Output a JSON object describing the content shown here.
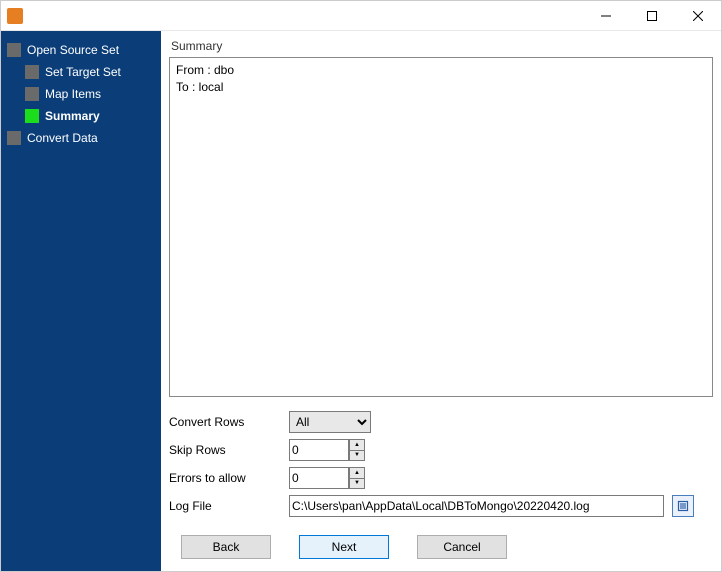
{
  "titlebar": {
    "title": ""
  },
  "sidebar": {
    "items": [
      {
        "label": "Open Source Set",
        "indent": 0,
        "active": false,
        "bold": false
      },
      {
        "label": "Set Target Set",
        "indent": 1,
        "active": false,
        "bold": false
      },
      {
        "label": "Map Items",
        "indent": 1,
        "active": false,
        "bold": false
      },
      {
        "label": "Summary",
        "indent": 1,
        "active": true,
        "bold": true
      },
      {
        "label": "Convert Data",
        "indent": 0,
        "active": false,
        "bold": false
      }
    ]
  },
  "content": {
    "group_label": "Summary",
    "summary_text": "From : dbo\nTo : local",
    "options": {
      "convert_rows_label": "Convert Rows",
      "convert_rows_value": "All",
      "skip_rows_label": "Skip Rows",
      "skip_rows_value": "0",
      "errors_label": "Errors to allow",
      "errors_value": "0",
      "logfile_label": "Log File",
      "logfile_value": "C:\\Users\\pan\\AppData\\Local\\DBToMongo\\20220420.log"
    }
  },
  "buttons": {
    "back": "Back",
    "next": "Next",
    "cancel": "Cancel"
  }
}
